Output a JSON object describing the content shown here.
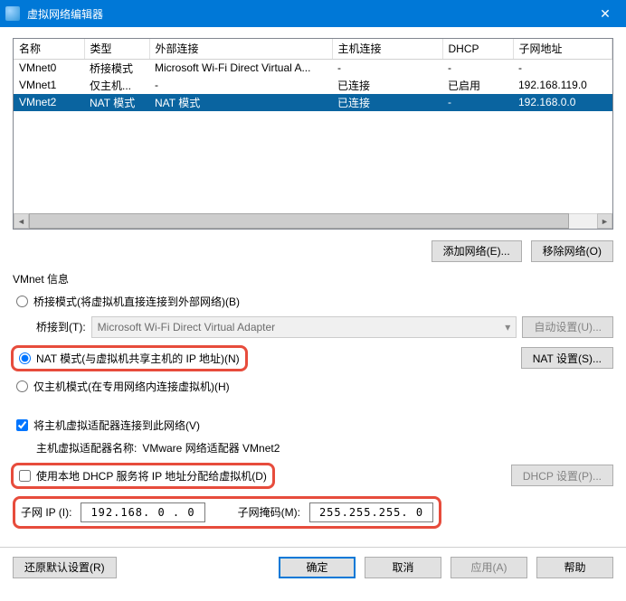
{
  "titlebar": {
    "title": "虚拟网络编辑器",
    "close": "✕"
  },
  "table": {
    "col_name": "名称",
    "col_type": "类型",
    "col_ext": "外部连接",
    "col_host": "主机连接",
    "col_dhcp": "DHCP",
    "col_subnet": "子网地址",
    "rows": [
      {
        "name": "VMnet0",
        "type": "桥接模式",
        "ext": "Microsoft Wi-Fi Direct Virtual A...",
        "host": "-",
        "dhcp": "-",
        "subnet": "-"
      },
      {
        "name": "VMnet1",
        "type": "仅主机...",
        "ext": "-",
        "host": "已连接",
        "dhcp": "已启用",
        "subnet": "192.168.119.0"
      },
      {
        "name": "VMnet2",
        "type": "NAT 模式",
        "ext": "NAT 模式",
        "host": "已连接",
        "dhcp": "-",
        "subnet": "192.168.0.0"
      }
    ]
  },
  "buttons": {
    "add_network": "添加网络(E)...",
    "remove_network": "移除网络(O)"
  },
  "vmnet_info": {
    "label": "VMnet 信息",
    "bridged": "桥接模式(将虚拟机直接连接到外部网络)(B)",
    "bridge_to": "桥接到(T):",
    "bridge_adapter": "Microsoft Wi-Fi Direct Virtual Adapter",
    "auto_settings": "自动设置(U)...",
    "nat": "NAT 模式(与虚拟机共享主机的 IP 地址)(N)",
    "nat_settings": "NAT 设置(S)...",
    "hostonly": "仅主机模式(在专用网络内连接虚拟机)(H)",
    "connect_host": "将主机虚拟适配器连接到此网络(V)",
    "host_adapter_label": "主机虚拟适配器名称:",
    "host_adapter_value": "VMware 网络适配器 VMnet2",
    "use_dhcp": "使用本地 DHCP 服务将 IP 地址分配给虚拟机(D)",
    "dhcp_settings": "DHCP 设置(P)...",
    "subnet_ip_label": "子网 IP (I):",
    "subnet_ip": "192.168. 0 . 0",
    "subnet_mask_label": "子网掩码(M):",
    "subnet_mask": "255.255.255. 0"
  },
  "bottom": {
    "restore": "还原默认设置(R)",
    "ok": "确定",
    "cancel": "取消",
    "apply": "应用(A)",
    "help": "帮助"
  }
}
